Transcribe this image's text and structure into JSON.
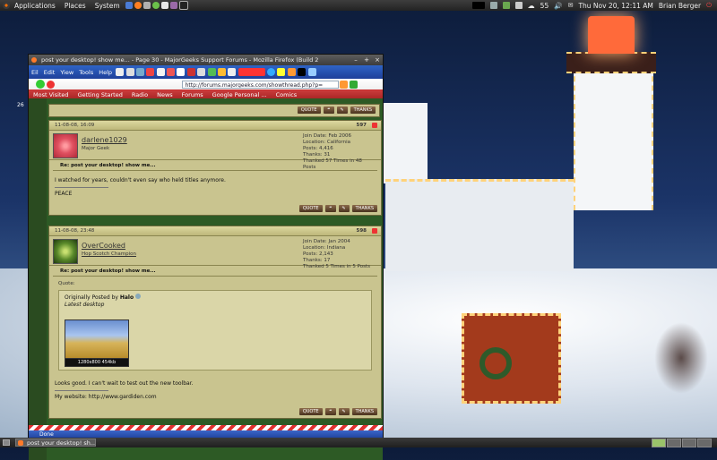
{
  "top_panel": {
    "menus": [
      "Applications",
      "Places",
      "System"
    ],
    "volume": "55",
    "clock": "Thu Nov 20, 12:11 AM",
    "user": "Brian Berger"
  },
  "firefox": {
    "title": "post your desktop! show me... - Page 30 - MajorGeeks Support Forums - Mozilla Firefox (Build 2",
    "menu": [
      "Eil",
      "Edit",
      "Yiew",
      "Tools",
      "Help"
    ],
    "url": "http://forums.majorgeeks.com/showthread.php?p=",
    "bookmarks": [
      "Most Visited",
      "Getting Started",
      "Radio",
      "News",
      "Forums",
      "Google Personal ...",
      "Comics"
    ],
    "status": "Done"
  },
  "posts": [
    {
      "date": "11-08-08, 16:09",
      "number": "597",
      "username": "darlene1029",
      "usertitle": "Major Geek",
      "info": [
        "Join Date: Feb 2006",
        "Location: California",
        "Posts: 4,416",
        "Thanks: 31",
        "Thanked 57 Times in 48 Posts"
      ],
      "title": "Re: post your desktop! show me...",
      "body": "I watched for years, couldn't even say who held titles anymore.",
      "signature": "PEACE"
    },
    {
      "date": "11-08-08, 23:48",
      "number": "598",
      "username": "OverCooked",
      "usertitle": "Hop Scotch Champion",
      "info": [
        "Join Date: Jan 2004",
        "Location: Indiana",
        "Posts: 2,143",
        "Thanks: 17",
        "Thanked 5 Times in 5 Posts"
      ],
      "title": "Re: post your desktop! show me...",
      "quote_label": "Quote:",
      "quote_by": "Originally Posted by",
      "quote_author": "Halo",
      "quote_text": "Latest desktop",
      "thumb_caption": "1280x800 454kb",
      "body": "Looks good. I can't wait to test out the new toolbar.",
      "signature": "My website: http://www.gardiden.com"
    }
  ],
  "buttons": {
    "quote": "QUOTE",
    "thanks": "THANKS"
  },
  "taskbar": {
    "task": "post your desktop! sh..."
  },
  "page_number_side": "26"
}
